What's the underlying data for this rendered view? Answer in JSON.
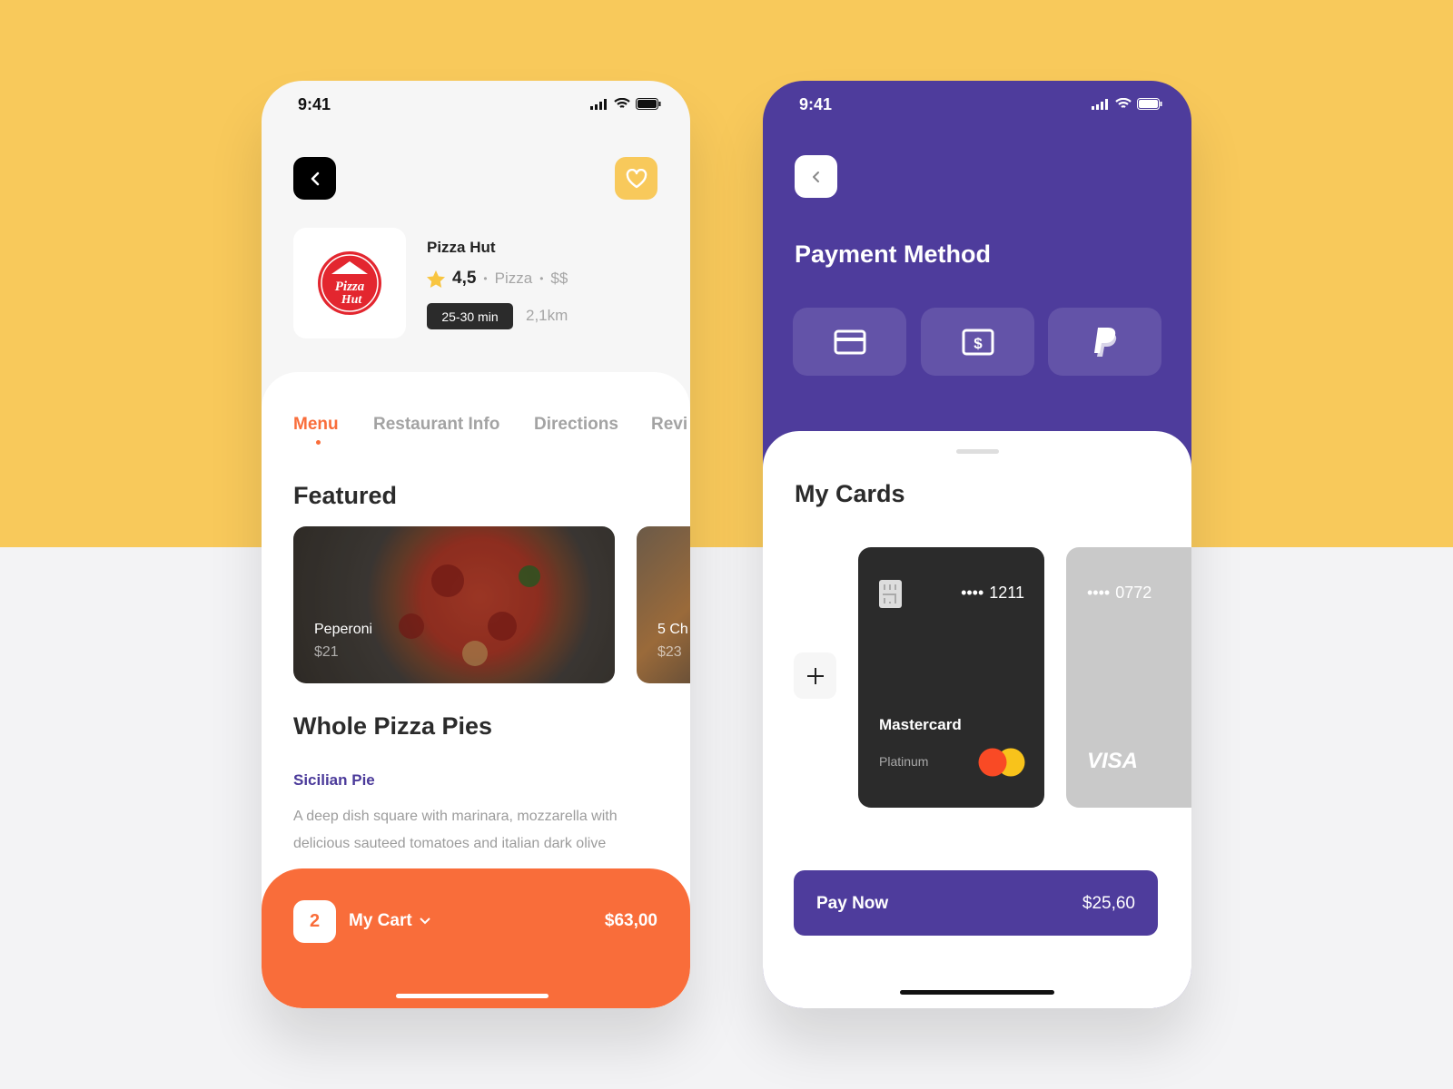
{
  "colors": {
    "yellow": "#f8c95b",
    "orange": "#f96d3a",
    "purple": "#4e3c9c",
    "dark": "#2b2b2b"
  },
  "restaurant_screen": {
    "status": {
      "time": "9:41"
    },
    "restaurant": {
      "name": "Pizza Hut",
      "rating": "4,5",
      "category": "Pizza",
      "price": "$$",
      "eta": "25-30 min",
      "distance": "2,1km",
      "separator": "•"
    },
    "tabs": [
      {
        "label": "Menu",
        "active": true
      },
      {
        "label": "Restaurant Info"
      },
      {
        "label": "Directions"
      },
      {
        "label": "Revi"
      }
    ],
    "featured": {
      "title": "Featured",
      "items": [
        {
          "name": "Peperoni",
          "price": "$21"
        },
        {
          "name": "5 Ch",
          "price": "$23"
        }
      ]
    },
    "section": {
      "title": "Whole Pizza Pies",
      "item_name": "Sicilian Pie",
      "item_desc_1": "A deep dish square with marinara, mozzarella with",
      "item_desc_2": "delicious sauteed tomatoes and italian dark olive"
    },
    "cart": {
      "count": "2",
      "label": "My Cart",
      "total": "$63,00"
    }
  },
  "payment_screen": {
    "status": {
      "time": "9:41"
    },
    "title": "Payment Method",
    "methods": [
      "credit-card-icon",
      "cash-icon",
      "paypal-icon"
    ],
    "cards_title": "My Cards",
    "cards": [
      {
        "mask": "••••",
        "last4": "1211",
        "brand": "Mastercard",
        "tier": "Platinum"
      },
      {
        "mask": "••••",
        "last4": "0772",
        "brand": "VISA"
      }
    ],
    "pay": {
      "label": "Pay Now",
      "amount": "$25,60"
    }
  }
}
